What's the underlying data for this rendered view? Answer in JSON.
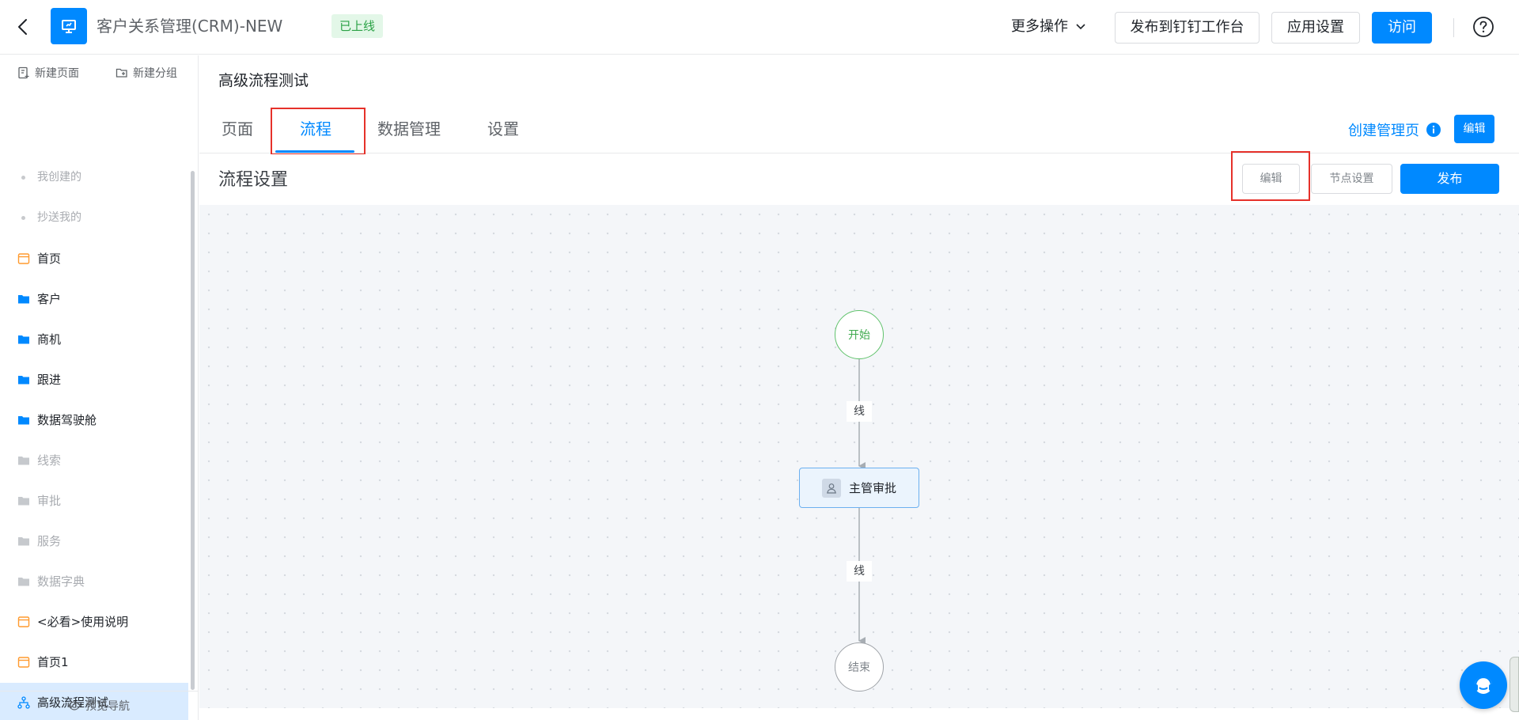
{
  "header": {
    "app_title": "客户关系管理(CRM)-NEW",
    "status_badge": "已上线",
    "more_ops": "更多操作",
    "publish_to_dingtalk": "发布到钉钉工作台",
    "app_settings": "应用设置",
    "visit": "访问"
  },
  "sidebar": {
    "new_page": "新建页面",
    "new_group": "新建分组",
    "sub_items": [
      "我创建的",
      "抄送我的"
    ],
    "items": [
      {
        "label": "首页",
        "icon": "page-icon",
        "color": "#ff9a2e"
      },
      {
        "label": "客户",
        "icon": "folder-icon",
        "color": "#0089ff"
      },
      {
        "label": "商机",
        "icon": "folder-icon",
        "color": "#0089ff"
      },
      {
        "label": "跟进",
        "icon": "folder-icon",
        "color": "#0089ff"
      },
      {
        "label": "数据驾驶舱",
        "icon": "folder-icon",
        "color": "#0089ff"
      },
      {
        "label": "线索",
        "icon": "folder-icon",
        "color": "#c6c9cd"
      },
      {
        "label": "审批",
        "icon": "folder-icon",
        "color": "#c6c9cd"
      },
      {
        "label": "服务",
        "icon": "folder-icon",
        "color": "#c6c9cd"
      },
      {
        "label": "数据字典",
        "icon": "folder-icon",
        "color": "#c6c9cd"
      },
      {
        "label": "<必看>使用说明",
        "icon": "page-icon",
        "color": "#ff9a2e"
      },
      {
        "label": "首页1",
        "icon": "page-icon",
        "color": "#ff9a2e"
      },
      {
        "label": "高级流程测试",
        "icon": "flow-icon",
        "color": "#0089ff"
      }
    ],
    "footer": "预览导航"
  },
  "main": {
    "page_heading": "高级流程测试",
    "tabs": [
      "页面",
      "流程",
      "数据管理",
      "设置"
    ],
    "active_tab": "流程",
    "create_admin_page": "创建管理页",
    "edit_small": "编辑",
    "flow_title": "流程设置",
    "flow_edit": "编辑",
    "node_settings": "节点设置",
    "publish": "发布"
  },
  "flow": {
    "start": "开始",
    "edge_label_1": "线",
    "approver": "主管审批",
    "edge_label_2": "线",
    "end": "结束"
  },
  "colors": {
    "primary": "#0089ff",
    "highlight_frame": "#e6312a",
    "online_green": "#2ba246"
  }
}
